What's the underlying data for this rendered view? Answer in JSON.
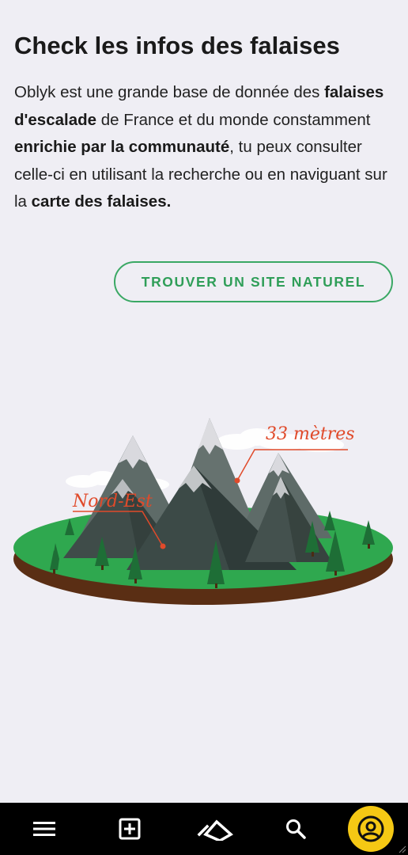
{
  "section": {
    "title": "Check les infos des falaises",
    "intro": {
      "t1": "Oblyk est une grande base de donnée des ",
      "b1": "falaises d'escalade",
      "t2": " de France et du monde constamment ",
      "b2": "enrichie par la communauté",
      "t3": ", tu peux consulter celle-ci en utilisant la recherche ou en naviguant sur la ",
      "b3": "carte des falaises.",
      "t4": ""
    },
    "cta_label": "TROUVER UN SITE NATUREL"
  },
  "illustration": {
    "label_height": "33 mètres",
    "label_orientation": "Nord-Est",
    "colors": {
      "ground": "#2fa84f",
      "soil": "#5a2e14",
      "mountain_dark": "#3c4a47",
      "mountain_light": "#566561",
      "snow": "#d8d8dc",
      "annotation": "#e04a2a"
    }
  },
  "bottom_nav": {
    "items": [
      "menu-icon",
      "add-box-icon",
      "oblyk-logo-icon",
      "search-icon",
      "account-circle-icon"
    ],
    "active_color": "#f5c814"
  }
}
